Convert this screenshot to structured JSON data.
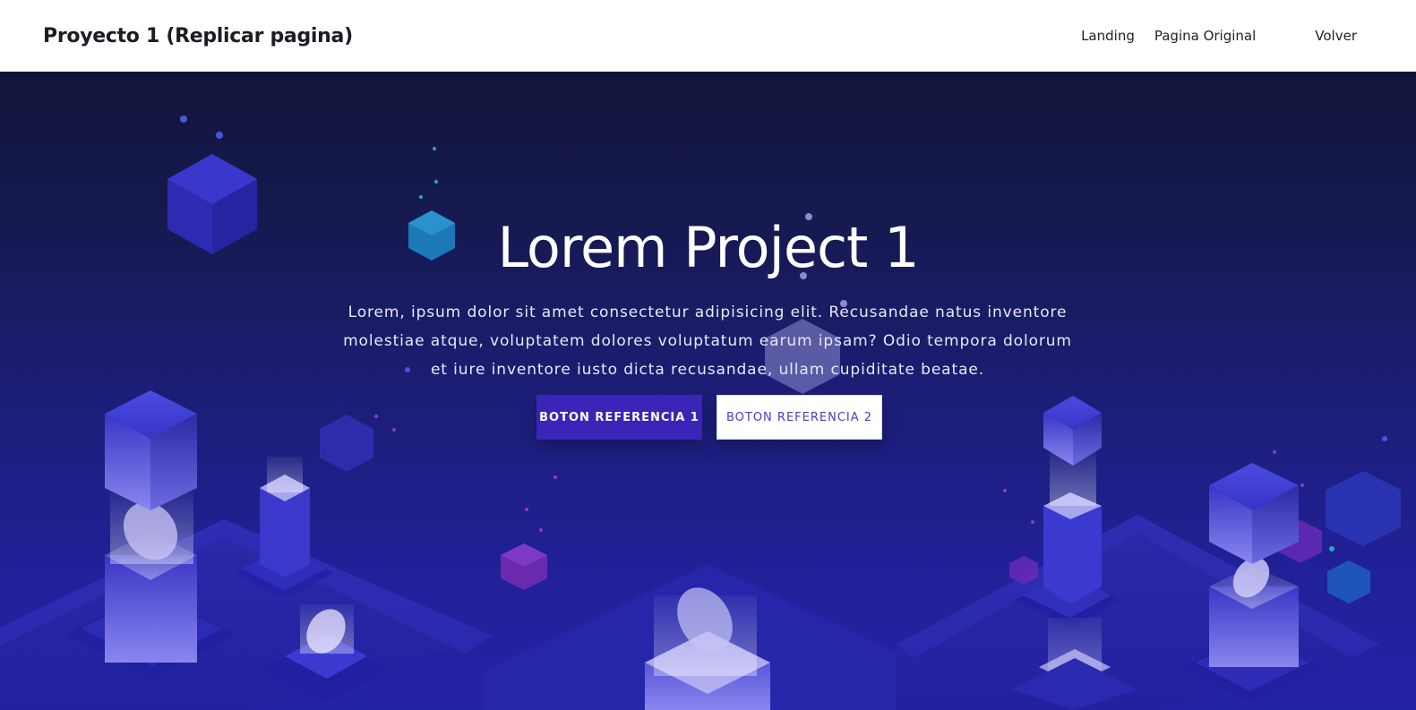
{
  "navbar": {
    "brand": "Proyecto 1 (Replicar pagina)",
    "links": [
      "Landing",
      "Pagina Original",
      "Volver"
    ]
  },
  "hero": {
    "title": "Lorem Project 1",
    "text": "Lorem, ipsum dolor sit amet consectetur adipisicing elit. Recusandae natus inventore molestiae atque, voluptatem dolores voluptatum earum ipsam? Odio tempora dolorum et iure inventore iusto dicta recusandae, ullam cupiditate beatae.",
    "primary_button": "BOTON REFERENCIA 1",
    "secondary_button": "BOTON REFERENCIA 2"
  },
  "colors": {
    "hero_top": "#12153a",
    "hero_bottom": "#2323a6",
    "primary_button": "#3b25b8",
    "secondary_button_text": "#4b3cc0"
  }
}
